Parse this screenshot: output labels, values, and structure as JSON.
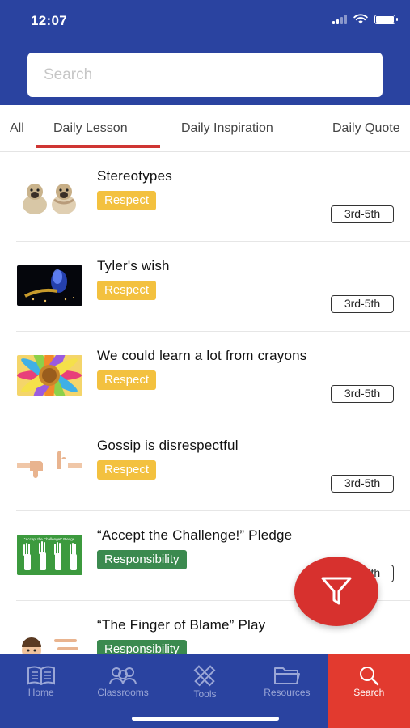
{
  "status_bar": {
    "time": "12:07",
    "battery_level_percent": 100
  },
  "search": {
    "placeholder": "Search",
    "value": ""
  },
  "tabs": [
    {
      "label": "All"
    },
    {
      "label": "Daily Lesson",
      "selected": true
    },
    {
      "label": "Daily Inspiration"
    },
    {
      "label": "Daily Quote"
    }
  ],
  "lessons": [
    {
      "title": "Stereotypes",
      "tag": "Respect",
      "grade": "3rd-5th"
    },
    {
      "title": "Tyler's wish",
      "tag": "Respect",
      "grade": "3rd-5th"
    },
    {
      "title": "We could learn a lot from crayons",
      "tag": "Respect",
      "grade": "3rd-5th"
    },
    {
      "title": "Gossip is disrespectful",
      "tag": "Respect",
      "grade": "3rd-5th"
    },
    {
      "title": "“Accept the Challenge!” Pledge",
      "tag": "Responsibility",
      "grade": "3rd-5th"
    },
    {
      "title": "“The Finger of Blame” Play",
      "tag": "Responsibility",
      "grade": ""
    }
  ],
  "thumb_text": {
    "pledge_title": "\"Accept the Challenge!\" Pledge"
  },
  "tag_colors": {
    "Respect": "#f3c13f",
    "Responsibility": "#3b8a4f"
  },
  "colors": {
    "header": "#2a43a0",
    "accent": "#cf3533",
    "fab": "#d7312e",
    "active_nav": "#e23a2f"
  },
  "nav": [
    {
      "label": "Home",
      "icon": "book-icon"
    },
    {
      "label": "Classrooms",
      "icon": "people-icon"
    },
    {
      "label": "Tools",
      "icon": "pencil-ruler-icon"
    },
    {
      "label": "Resources",
      "icon": "folder-icon"
    },
    {
      "label": "Search",
      "icon": "search-icon",
      "active": true
    }
  ],
  "fab": {
    "icon": "filter-icon"
  }
}
